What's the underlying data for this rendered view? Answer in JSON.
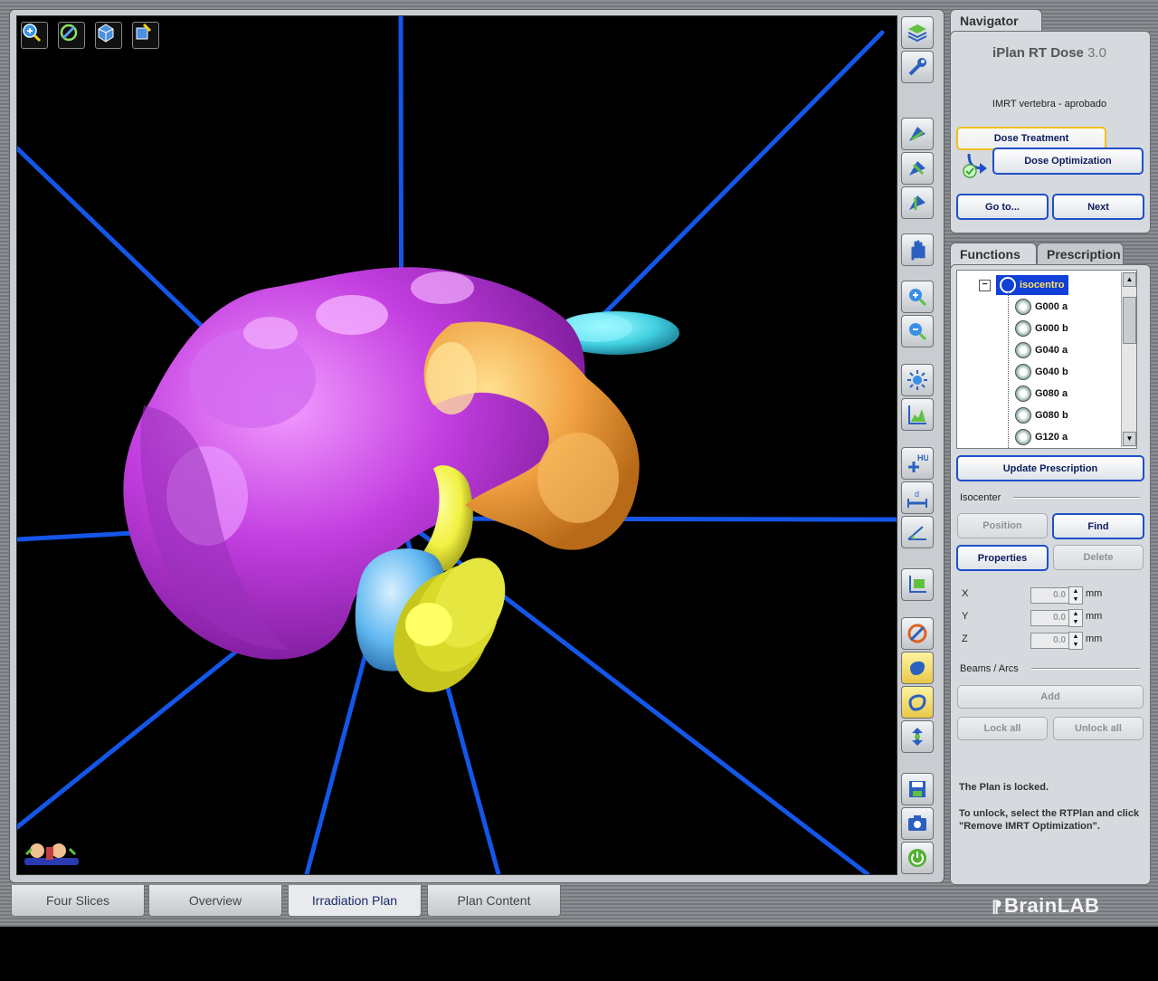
{
  "top_tools": [
    {
      "icon": "zoom-in-icon"
    },
    {
      "icon": "rotate-icon"
    },
    {
      "icon": "3d-orient-icon"
    },
    {
      "icon": "reset-view-icon"
    }
  ],
  "toolbar": [
    {
      "icon": "layers-icon"
    },
    {
      "icon": "wrench-icon"
    },
    {
      "icon": "view-axial-icon"
    },
    {
      "icon": "view-coronal-icon"
    },
    {
      "icon": "view-sagittal-icon"
    },
    {
      "icon": "hand-pan-icon"
    },
    {
      "icon": "zoom-in-icon"
    },
    {
      "icon": "zoom-out-icon"
    },
    {
      "icon": "brightness-icon"
    },
    {
      "icon": "dvh-icon"
    },
    {
      "icon": "hu-add-icon",
      "text": "HU"
    },
    {
      "icon": "distance-icon"
    },
    {
      "icon": "angle-icon"
    },
    {
      "icon": "roi-icon"
    },
    {
      "icon": "color-table-icon"
    },
    {
      "icon": "object-blue-icon",
      "active": true
    },
    {
      "icon": "object-outline-icon",
      "active": true
    },
    {
      "icon": "flip-icon"
    },
    {
      "icon": "save-icon"
    },
    {
      "icon": "screenshot-icon"
    },
    {
      "icon": "power-icon"
    }
  ],
  "navigator": {
    "tab": "Navigator",
    "product": "iPlan RT Dose",
    "version": "3.0",
    "plan_name": "IMRT vertebra - aprobado",
    "step_current": "Dose Treatment",
    "step_next": "Dose Optimization",
    "goto_label": "Go to...",
    "next_label": "Next"
  },
  "functions": {
    "tabs": [
      "Functions",
      "Prescription"
    ],
    "tree": {
      "root": "isocentro",
      "items": [
        "G000 a",
        "G000 b",
        "G040 a",
        "G040 b",
        "G080 a",
        "G080 b",
        "G120 a"
      ]
    },
    "update_prescription": "Update Prescription",
    "isocenter_title": "Isocenter",
    "position_label": "Position",
    "find_label": "Find",
    "properties_label": "Properties",
    "delete_label": "Delete",
    "coords": [
      {
        "axis": "X",
        "value": "0.0",
        "unit": "mm"
      },
      {
        "axis": "Y",
        "value": "0.0",
        "unit": "mm"
      },
      {
        "axis": "Z",
        "value": "0.0",
        "unit": "mm"
      }
    ],
    "beams_title": "Beams / Arcs",
    "add_label": "Add",
    "lock_all": "Lock all",
    "unlock_all": "Unlock all",
    "locked_msg": "The Plan is locked.",
    "unlock_hint": "To unlock, select the RTPlan and click \"Remove IMRT Optimization\"."
  },
  "bottom_tabs": [
    {
      "label": "Four Slices",
      "active": false
    },
    {
      "label": "Overview",
      "active": false
    },
    {
      "label": "Irradiation Plan",
      "active": true
    },
    {
      "label": "Plan Content",
      "active": false
    }
  ],
  "brand": "BrainLAB",
  "colors": {
    "accent_blue": "#1f4fc8",
    "beam_line": "#1456e8",
    "structure_magenta": "#c040e0",
    "structure_orange": "#f0a040",
    "structure_yellow": "#f0f040",
    "structure_cyan": "#40d0e0",
    "structure_lightblue": "#60b8f0"
  }
}
